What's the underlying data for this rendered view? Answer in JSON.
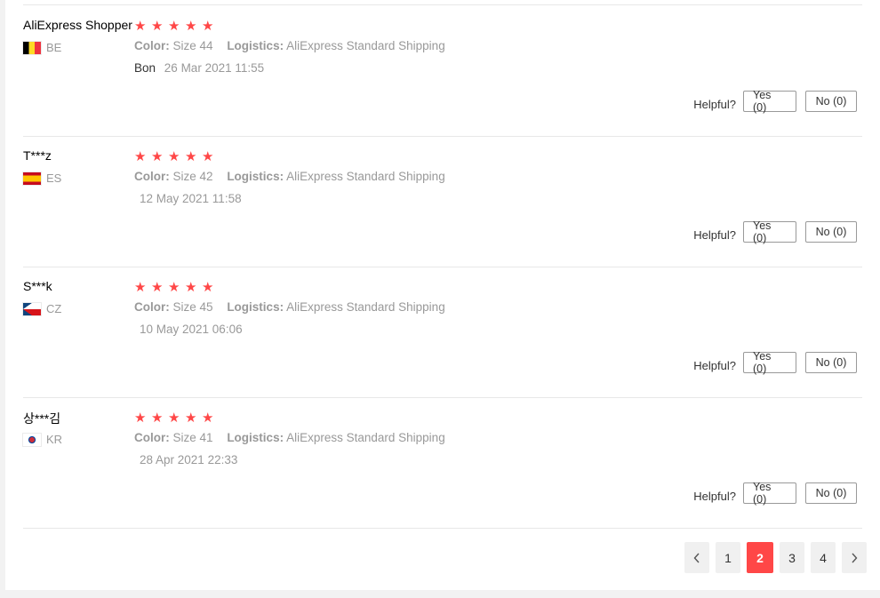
{
  "colors": {
    "accent": "#ff4747",
    "star": "#ff4747"
  },
  "reviews": [
    {
      "user": "AliExpress Shopper",
      "country": "BE",
      "flag": "belgium-flag",
      "stars": 5,
      "color_label": "Color:",
      "color_value": "Size 44",
      "logistics_label": "Logistics:",
      "logistics_value": "AliExpress Standard Shipping",
      "text": "Bon",
      "date": "26 Mar 2021 11:55",
      "helpful_label": "Helpful?",
      "yes_label": "Yes (0)",
      "no_label": "No (0)"
    },
    {
      "user": "T***z",
      "country": "ES",
      "flag": "spain-flag",
      "stars": 5,
      "color_label": "Color:",
      "color_value": "Size 42",
      "logistics_label": "Logistics:",
      "logistics_value": "AliExpress Standard Shipping",
      "text": "",
      "date": "12 May 2021 11:58",
      "helpful_label": "Helpful?",
      "yes_label": "Yes (0)",
      "no_label": "No (0)"
    },
    {
      "user": "S***k",
      "country": "CZ",
      "flag": "czech-flag",
      "stars": 5,
      "color_label": "Color:",
      "color_value": "Size 45",
      "logistics_label": "Logistics:",
      "logistics_value": "AliExpress Standard Shipping",
      "text": "",
      "date": "10 May 2021 06:06",
      "helpful_label": "Helpful?",
      "yes_label": "Yes (0)",
      "no_label": "No (0)"
    },
    {
      "user": "상***김",
      "country": "KR",
      "flag": "korea-flag",
      "stars": 5,
      "color_label": "Color:",
      "color_value": "Size 41",
      "logistics_label": "Logistics:",
      "logistics_value": "AliExpress Standard Shipping",
      "text": "",
      "date": "28 Apr 2021 22:33",
      "helpful_label": "Helpful?",
      "yes_label": "Yes (0)",
      "no_label": "No (0)"
    }
  ],
  "pagination": {
    "prev_icon": "chevron-left-icon",
    "next_icon": "chevron-right-icon",
    "pages": [
      "1",
      "2",
      "3",
      "4"
    ],
    "current": "2"
  }
}
